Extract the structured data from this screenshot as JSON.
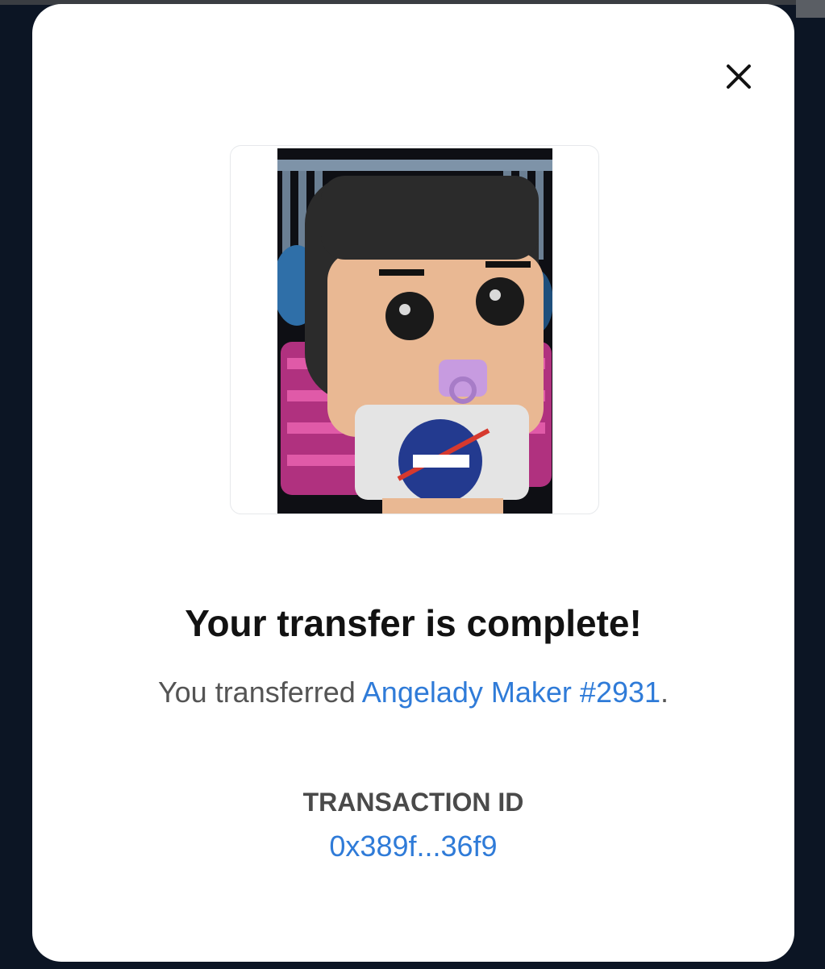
{
  "modal": {
    "close_icon": "close-icon",
    "title": "Your transfer is complete!",
    "subtitle_prefix": "You transferred ",
    "item_name": "Angelady Maker #2931",
    "subtitle_suffix": ".",
    "transaction_label": "TRANSACTION ID",
    "transaction_id": "0x389f...36f9"
  },
  "colors": {
    "link": "#2f7bd8",
    "backdrop": "#0c1524",
    "title": "#121212"
  }
}
